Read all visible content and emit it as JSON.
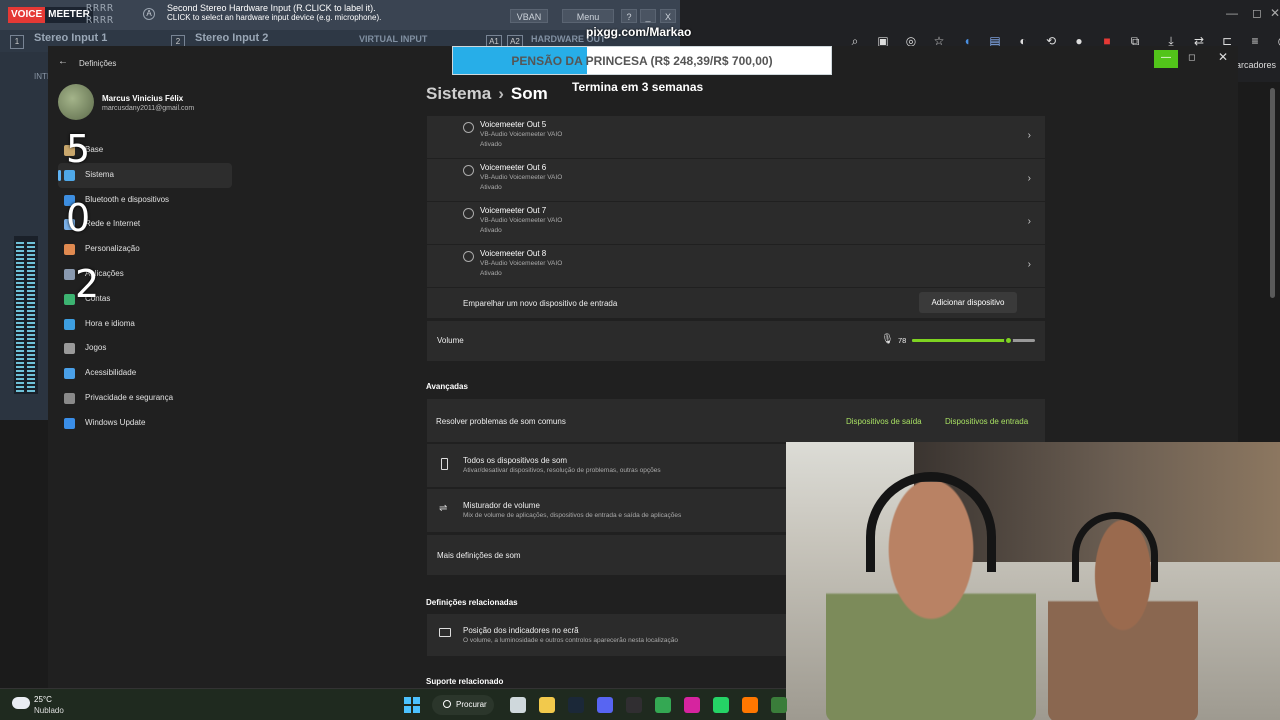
{
  "voicemeeter": {
    "logo_part1": "VOICE",
    "logo_part2": "MEETER",
    "rrr_row1": "RRRR",
    "rrr_row2": "RRRR",
    "a_badge": "A",
    "hint_line1": "Second Stereo Hardware Input (R.CLICK to label it).",
    "hint_line2": "CLICK to select an hardware input device (e.g. microphone).",
    "vban_label": "VBAN",
    "menu_label": "Menu",
    "help_label": "?",
    "min_label": "_",
    "close_label": "X",
    "input1_num": "1",
    "input1": "Stereo Input 1",
    "input2_num": "2",
    "input2": "Stereo Input 2",
    "virtual_input": "VIRTUAL INPUT",
    "a1": "A1",
    "a2": "A2",
    "hardware_out": "HARDWARE OUT",
    "intro_label": "INTI"
  },
  "donation": {
    "url": "pixgg.com/Markao",
    "goal_text": "PENSÃO DA PRINCESA (R$ 248,39/R$ 700,00)",
    "progress": 0.355,
    "ends_text": "Termina em 3 semanas",
    "bar_color": "#27aee8"
  },
  "overlay_numbers": [
    "5",
    "0",
    "2"
  ],
  "browser": {
    "bookmarks_label": "arcadores",
    "win_min": "—",
    "win_restore": "◻",
    "win_close": "✕",
    "icons": [
      "zoom-icon",
      "screen-cast-icon",
      "eye-off-icon",
      "star-icon",
      "audio-icon",
      "extension-icon",
      "extension-icon",
      "extension-icon",
      "extension-icon",
      "extension-icon",
      "puzzle-icon",
      "download-icon",
      "translate-icon",
      "cast-icon",
      "playlist-icon",
      "profile-icon",
      "menu-icon"
    ]
  },
  "settings": {
    "window_title": "Definições",
    "back_icon": "←",
    "min_icon": "—",
    "max_icon": "◻",
    "close_icon": "✕",
    "user_name": "Marcus Vinicius Félix",
    "user_email": "marcusdany2011@gmail.com",
    "nav": [
      {
        "label": "Base",
        "icon_color": "#c9a76c"
      },
      {
        "label": "Sistema",
        "icon_color": "#4fa8e8",
        "active": true
      },
      {
        "label": "Bluetooth e dispositivos",
        "icon_color": "#3d8ee0"
      },
      {
        "label": "Rede e Internet",
        "icon_color": "#7ab0e8"
      },
      {
        "label": "Personalização",
        "icon_color": "#e08a50"
      },
      {
        "label": "Aplicações",
        "icon_color": "#8a9ab0"
      },
      {
        "label": "Contas",
        "icon_color": "#3cb371"
      },
      {
        "label": "Hora e idioma",
        "icon_color": "#3d9ee0"
      },
      {
        "label": "Jogos",
        "icon_color": "#9a9a9a"
      },
      {
        "label": "Acessibilidade",
        "icon_color": "#4aa0e8"
      },
      {
        "label": "Privacidade e segurança",
        "icon_color": "#8a8a8a"
      },
      {
        "label": "Windows Update",
        "icon_color": "#3a8ee8"
      }
    ],
    "breadcrumb_parent": "Sistema",
    "breadcrumb_sep": "›",
    "breadcrumb_current": "Som",
    "devices": [
      {
        "name": "Voicemeeter Out 5",
        "sub": "VB-Audio Voicemeeter VAIO",
        "state": "Ativado"
      },
      {
        "name": "Voicemeeter Out 6",
        "sub": "VB-Audio Voicemeeter VAIO",
        "state": "Ativado"
      },
      {
        "name": "Voicemeeter Out 7",
        "sub": "VB-Audio Voicemeeter VAIO",
        "state": "Ativado"
      },
      {
        "name": "Voicemeeter Out 8",
        "sub": "VB-Audio Voicemeeter VAIO",
        "state": "Ativado"
      }
    ],
    "pair_label": "Emparelhar um novo dispositivo de entrada",
    "add_device": "Adicionar dispositivo",
    "volume_label": "Volume",
    "volume_value": "78",
    "volume_level": 0.78,
    "advanced_title": "Avançadas",
    "troubleshoot_label": "Resolver problemas de som comuns",
    "output_devices_link": "Dispositivos de saída",
    "input_devices_link": "Dispositivos de entrada",
    "all_devices_title": "Todos os dispositivos de som",
    "all_devices_sub": "Ativar/desativar dispositivos, resolução de problemas, outras opções",
    "mixer_title": "Misturador de volume",
    "mixer_sub": "Mix de volume de aplicações, dispositivos de entrada e saída de aplicações",
    "more_settings": "Mais definições de som",
    "related_title": "Definições relacionadas",
    "indicators_title": "Posição dos indicadores no ecrã",
    "indicators_sub": "O volume, a luminosidade e outros controlos aparecerão nesta localização",
    "support_title": "Suporte relacionado"
  },
  "taskbar": {
    "temp": "25°C",
    "weather": "Nublado",
    "search_label": "Procurar",
    "apps": [
      {
        "name": "file-view-icon",
        "color": "#cfd8dc"
      },
      {
        "name": "file-explorer-icon",
        "color": "#f2c94c"
      },
      {
        "name": "steam-icon",
        "color": "#1b2838"
      },
      {
        "name": "discord-icon",
        "color": "#5865f2"
      },
      {
        "name": "obs-icon",
        "color": "#302e31"
      },
      {
        "name": "chrome-icon",
        "color": "#34a853"
      },
      {
        "name": "instagram-icon",
        "color": "#d6249f"
      },
      {
        "name": "whatsapp-icon",
        "color": "#25d366"
      },
      {
        "name": "soundcloud-icon",
        "color": "#ff7700"
      },
      {
        "name": "terminal-icon",
        "color": "#3a7d3a"
      }
    ]
  }
}
